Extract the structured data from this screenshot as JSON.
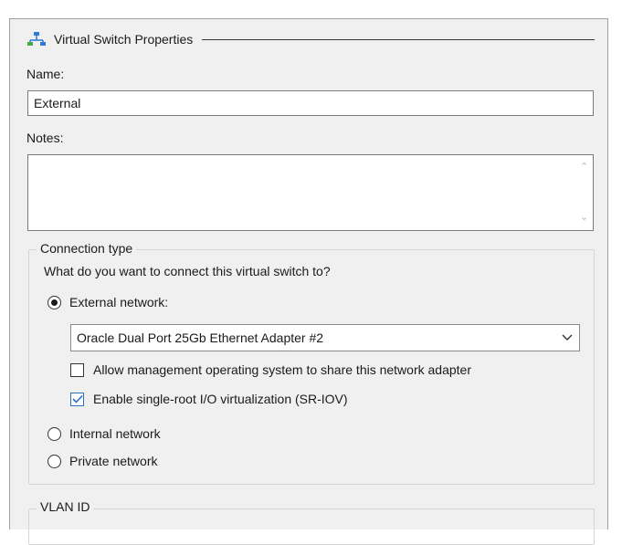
{
  "header": {
    "title": "Virtual Switch Properties",
    "icon": "network-switch-icon"
  },
  "name_field": {
    "label": "Name:",
    "value": "External"
  },
  "notes_field": {
    "label": "Notes:",
    "value": ""
  },
  "connection_type": {
    "legend": "Connection type",
    "question": "What do you want to connect this virtual switch to?",
    "options": [
      {
        "label": "External network:",
        "selected": true
      },
      {
        "label": "Internal network",
        "selected": false
      },
      {
        "label": "Private network",
        "selected": false
      }
    ],
    "adapter": {
      "selected": "Oracle Dual Port 25Gb Ethernet Adapter #2"
    },
    "checkboxes": [
      {
        "label": "Allow management operating system to share this network adapter",
        "checked": false
      },
      {
        "label": "Enable single-root I/O virtualization (SR-IOV)",
        "checked": true
      }
    ]
  },
  "vlan": {
    "legend": "VLAN ID"
  },
  "colors": {
    "panel": "#f0f0f0",
    "check_accent": "#2f6fbf",
    "icon_blue": "#2e7bd6",
    "icon_green": "#4aa84a"
  }
}
